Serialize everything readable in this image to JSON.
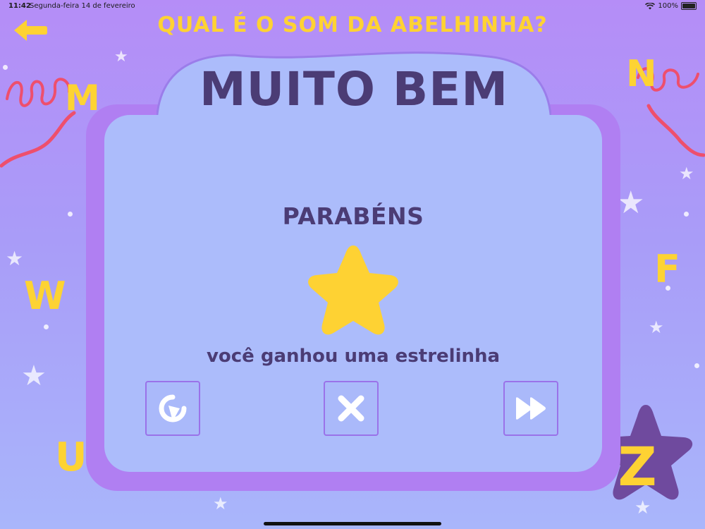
{
  "status_bar": {
    "time": "11:42",
    "date": "Segunda-feira 14 de fevereiro",
    "battery": "100%"
  },
  "header": {
    "question": "QUAL É O SOM DA ABELHINHA?"
  },
  "background_letters": {
    "m": "M",
    "n": "N",
    "w": "W",
    "f": "F",
    "u": "U",
    "z": "Z"
  },
  "dialog": {
    "banner_title": "MUITO BEM",
    "heading": "PARABÉNS",
    "message": "você ganhou uma estrelinha"
  },
  "colors": {
    "accent_yellow": "#fed233",
    "text_dark": "#4b3c75",
    "panel_purple": "#b07ff2",
    "panel_blue": "#acbcfb"
  },
  "icons": [
    "back-arrow-icon",
    "wifi-icon",
    "battery-icon",
    "star-icon",
    "replay-icon",
    "close-icon",
    "fast-forward-icon"
  ]
}
